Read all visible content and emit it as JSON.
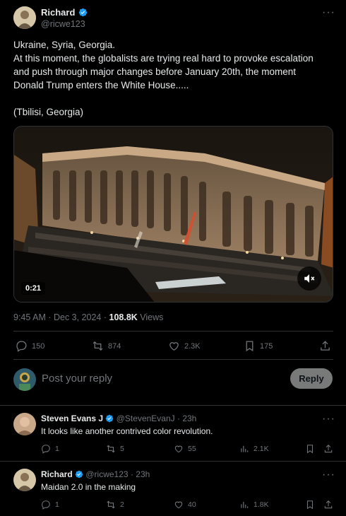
{
  "post": {
    "author_name": "Richard",
    "author_handle": "@ricwe123",
    "text_lines": [
      "Ukraine, Syria, Georgia.",
      "At this moment, the globalists are trying real hard to provoke escalation",
      "and push through major changes before January 20th, the moment",
      "Donald Trump enters the White House.....",
      "",
      "(Tbilisi, Georgia)"
    ],
    "video_duration": "0:21",
    "timestamp": "9:45 AM · Dec 3, 2024 · ",
    "views_count": "108.8K",
    "views_label": "Views",
    "stats": {
      "replies": "150",
      "reposts": "874",
      "likes": "2.3K",
      "bookmarks": "175"
    }
  },
  "composer": {
    "placeholder": "Post your reply",
    "reply_button": "Reply"
  },
  "replies": [
    {
      "author_name": "Steven Evans J",
      "author_handle": "@StevenEvanJ",
      "time": "· 23h",
      "text": "It looks like another contrived color revolution.",
      "stats": {
        "replies": "1",
        "reposts": "5",
        "likes": "55",
        "views": "2.1K"
      }
    },
    {
      "author_name": "Richard",
      "author_handle": "@ricwe123",
      "time": "· 23h",
      "text": "Maidan 2.0 in the making",
      "stats": {
        "replies": "1",
        "reposts": "2",
        "likes": "40",
        "views": "1.8K"
      }
    }
  ],
  "colors": {
    "background": "#000000",
    "text": "#e7e9ea",
    "muted": "#71767b",
    "verified": "#1d9bf0",
    "divider": "#2f3336"
  }
}
